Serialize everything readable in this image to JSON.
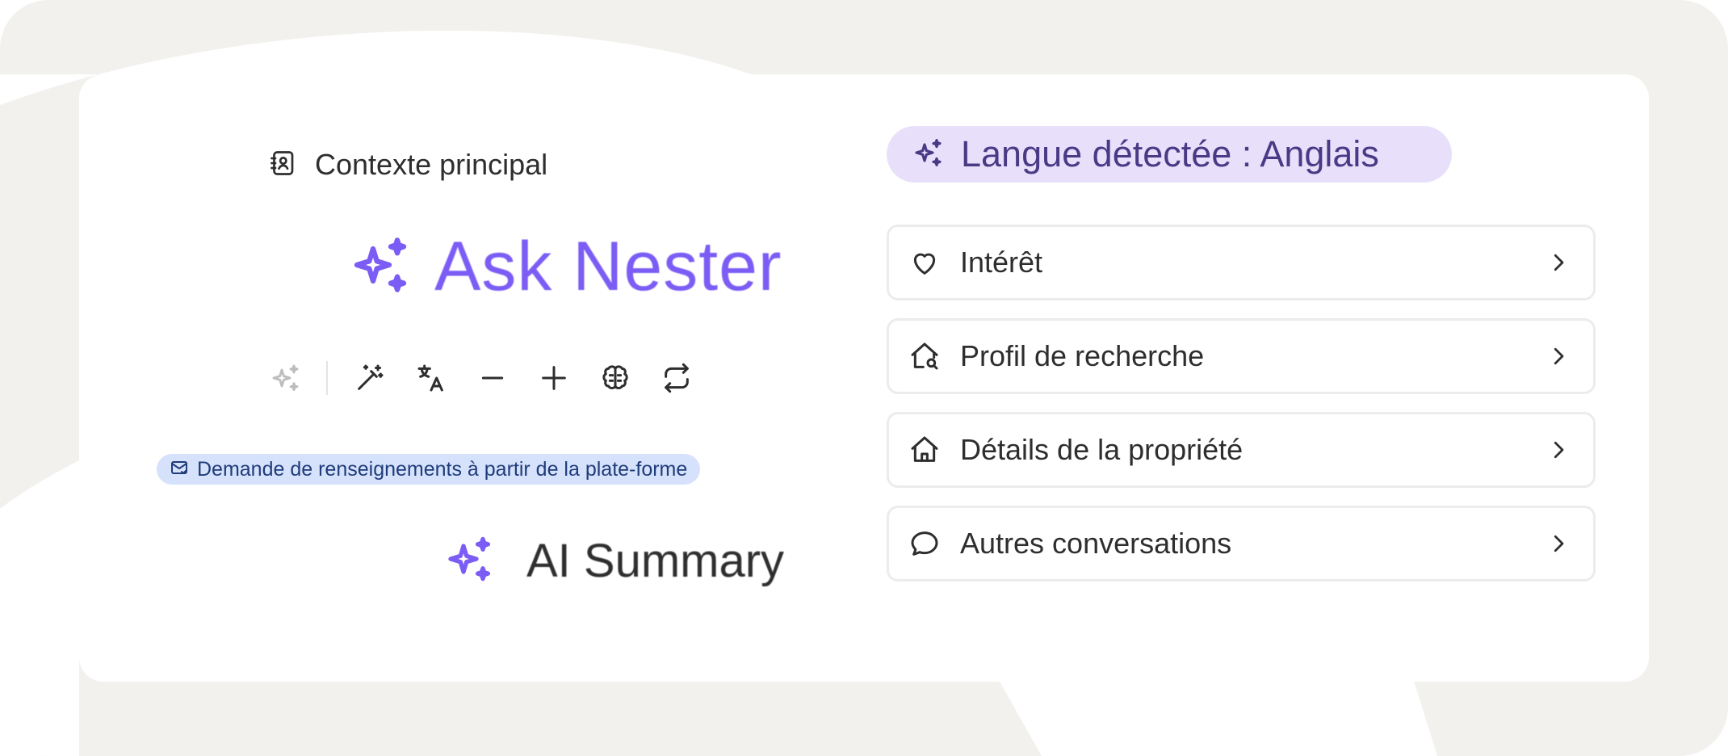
{
  "left": {
    "context_label": "Contexte principal",
    "ask_label": "Ask Nester",
    "source_pill": "Demande de renseignements à partir de la plate-forme",
    "summary_label": "AI Summary",
    "toolbar": [
      "sparkles-icon",
      "magic-wand-icon",
      "translate-icon",
      "minus-icon",
      "plus-icon",
      "brain-icon",
      "repeat-icon"
    ]
  },
  "right": {
    "language_badge": "Langue détectée : Anglais",
    "items": [
      {
        "label": "Intérêt",
        "icon": "heart-icon"
      },
      {
        "label": "Profil de recherche",
        "icon": "home-search-icon"
      },
      {
        "label": "Détails de la propriété",
        "icon": "home-icon"
      },
      {
        "label": "Autres conversations",
        "icon": "chat-bubble-icon"
      }
    ]
  },
  "colors": {
    "accent_purple": "#7b5cf5",
    "language_badge_bg": "#e8e0fb",
    "language_badge_text": "#4a3a86",
    "source_pill_bg": "#d6e2fb",
    "source_pill_text": "#1f3c7a",
    "background": "#f2f1ee"
  }
}
